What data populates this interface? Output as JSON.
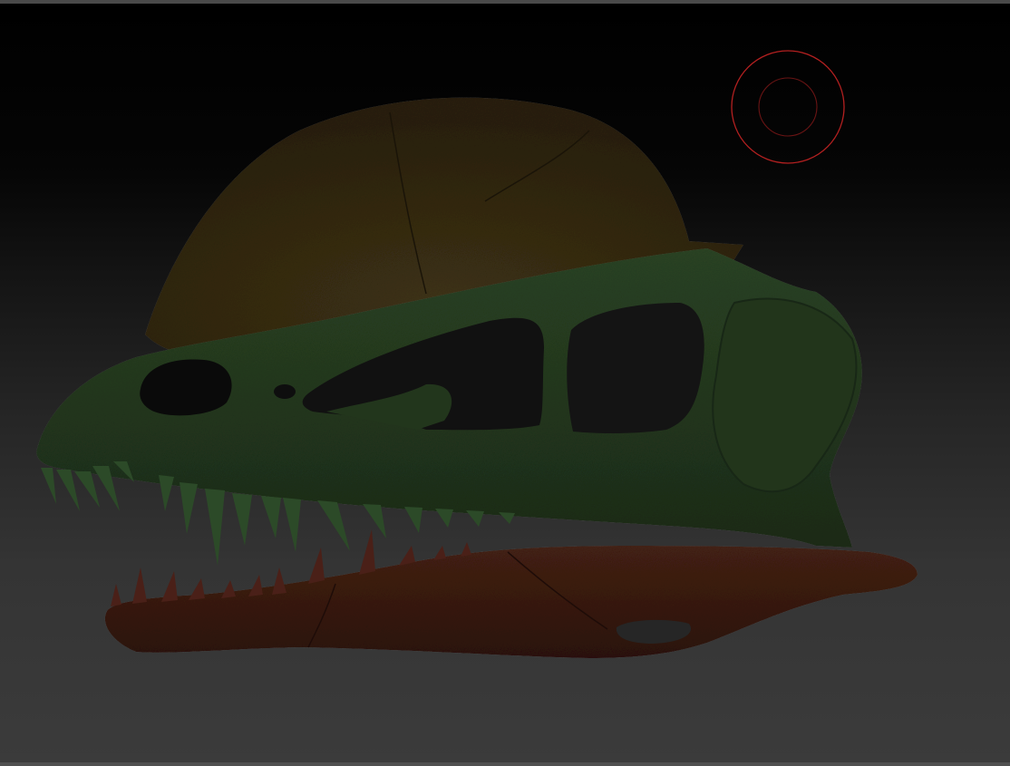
{
  "viewport": {
    "background_top": "#000000",
    "background_bottom": "#3b3b3b"
  },
  "model": {
    "crest_color": "#3a2c12",
    "skull_color": "#24381e",
    "jaw_color": "#3d1c12",
    "teeth_upper_color": "#2c4a28",
    "teeth_lower_color": "#4a2018"
  },
  "brush_cursor": {
    "color": "#b42020",
    "icon": "brush-cursor-icon"
  }
}
